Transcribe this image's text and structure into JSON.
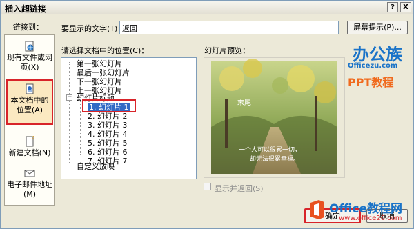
{
  "window": {
    "title": "插入超链接",
    "help_btn": "?",
    "close_btn": "X"
  },
  "nav": {
    "caption": "链接到：",
    "items": [
      {
        "label": "现有文件或网页(X)",
        "icon": "globe-file-icon"
      },
      {
        "label": "本文档中的位置(A)",
        "icon": "document-anchor-icon",
        "selected": true
      },
      {
        "label": "新建文档(N)",
        "icon": "new-document-icon"
      },
      {
        "label": "电子邮件地址(M)",
        "icon": "email-icon"
      }
    ]
  },
  "display_text": {
    "label": "要显示的文字(T)：",
    "value": "返回"
  },
  "screentip_btn": "屏幕提示(P)...",
  "tree": {
    "label": "请选择文档中的位置(C)：",
    "items": [
      "第一张幻灯片",
      "最后一张幻灯片",
      "下一张幻灯片",
      "上一张幻灯片",
      "幻灯片标题",
      "1. 幻灯片 1",
      "2. 幻灯片 2",
      "3. 幻灯片 3",
      "4. 幻灯片 4",
      "5. 幻灯片 5",
      "6. 幻灯片 6",
      "7. 幻灯片 7",
      "自定义放映"
    ],
    "selected_index": 5
  },
  "preview": {
    "label": "幻灯片预览：",
    "slide_caption": "末尾",
    "slide_text_line1": "一个人可以很累一切，",
    "slide_text_line2": "却无法很累幸福。"
  },
  "show_return": {
    "label": "显示并返回(S)",
    "checked": false
  },
  "ok_btn": "确定",
  "cancel_btn": "取消",
  "watermarks": {
    "top_logo": "办公族",
    "top_url": "Officezu.com",
    "top_sub": "PPT教程",
    "bottom_logo": "Office教程网",
    "bottom_url": "www.office26.com"
  },
  "colors": {
    "highlight_red": "#d8242a",
    "selection_blue": "#316ac5",
    "watermark_blue": "#1a73c8",
    "watermark_orange": "#f06a1d"
  }
}
